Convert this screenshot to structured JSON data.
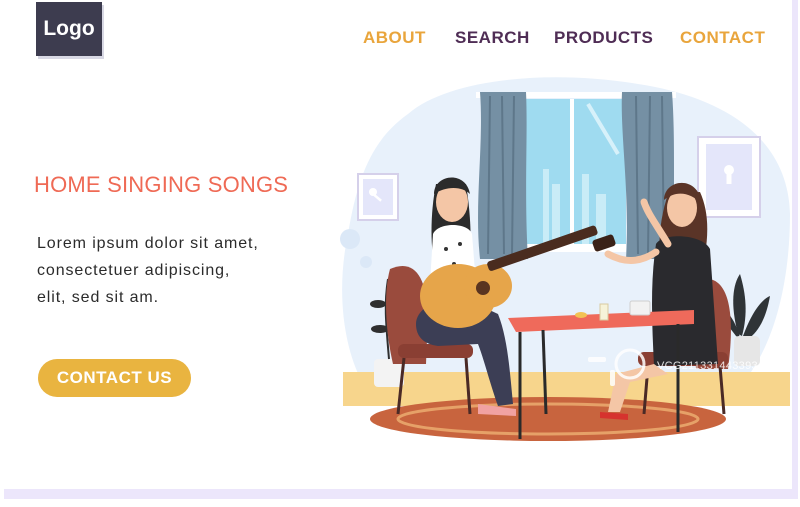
{
  "logo": {
    "label": "Logo"
  },
  "nav": [
    {
      "label": "ABOUT",
      "color": "#e9a53c"
    },
    {
      "label": "SEARCH",
      "color": "#4f2d55"
    },
    {
      "label": "PRODUCTS",
      "color": "#4f2d55"
    },
    {
      "label": "CONTACT",
      "color": "#e9a53c"
    }
  ],
  "hero": {
    "headline": "HOME SINGING SONGS",
    "body_lines": [
      "Lorem ipsum dolor sit amet,",
      "consectetuer adipiscing,",
      "elit, sed sit am."
    ],
    "cta_label": "CONTACT US"
  },
  "watermark": {
    "text": "VCG211331443393"
  },
  "colors": {
    "accent_orange": "#e9b440",
    "headline_red": "#ef6a55",
    "nav_purple": "#4f2d55",
    "logo_bg": "#3d3c4f"
  }
}
